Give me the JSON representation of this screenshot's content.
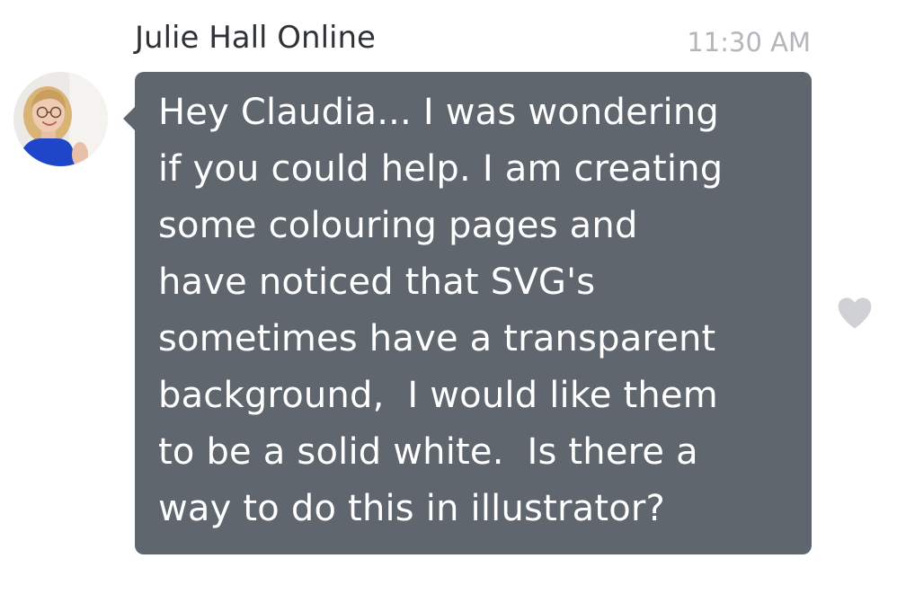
{
  "message": {
    "sender_name": "Julie Hall Online",
    "timestamp": "11:30 AM",
    "lines": [
      "Hey Claudia... I was wondering",
      "if you could help. I am creating",
      "some colouring pages and",
      "have noticed that SVG's",
      "sometimes have a transparent",
      "background,  I would like them",
      "to be a solid white.  Is there a",
      "way to do this in illustrator?"
    ]
  },
  "icons": {
    "avatar": "avatar-photo",
    "like": "heart-icon"
  },
  "colors": {
    "bubble": "#5f666e",
    "message_text": "#ffffff",
    "sender_name": "#2f3338",
    "timestamp": "#b3b6ba",
    "heart": "#cfd1d4"
  }
}
